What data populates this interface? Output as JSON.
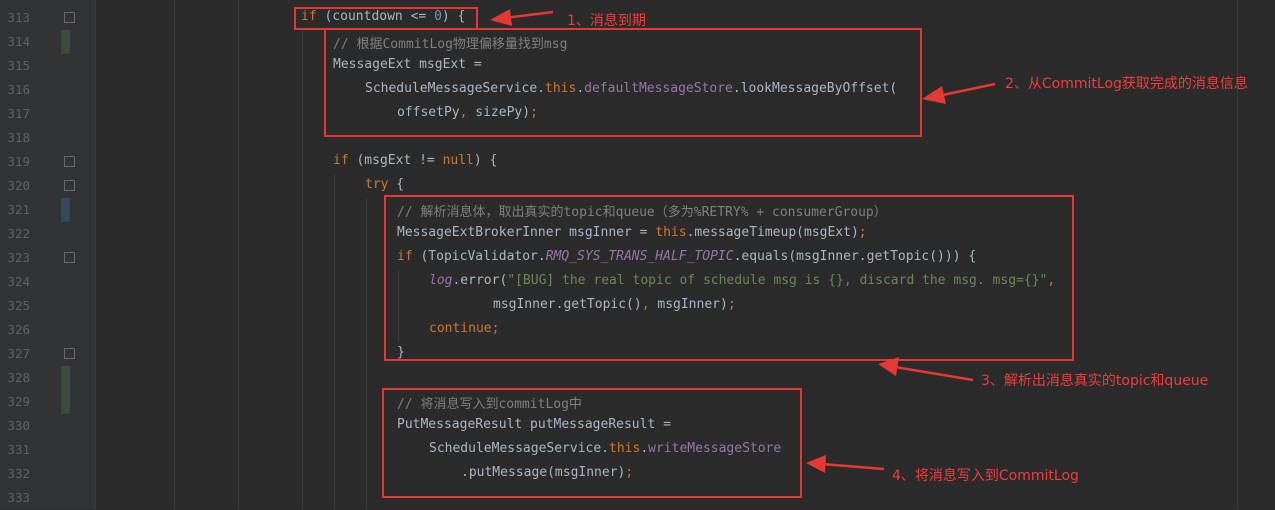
{
  "editor": {
    "lines": [
      {
        "num": "313",
        "indent": 0,
        "parts": [
          [
            "kw",
            "if"
          ],
          [
            "t",
            " (countdown <= "
          ],
          [
            "num",
            "0"
          ],
          [
            "t",
            ") {"
          ]
        ]
      },
      {
        "num": "314",
        "indent": 1,
        "parts": [
          [
            "cmt",
            "// 根据CommitLog物理偏移量找到msg"
          ]
        ]
      },
      {
        "num": "315",
        "indent": 1,
        "parts": [
          [
            "t",
            "MessageExt msgExt ="
          ]
        ]
      },
      {
        "num": "316",
        "indent": 2,
        "parts": [
          [
            "t",
            "ScheduleMessageService."
          ],
          [
            "kw",
            "this"
          ],
          [
            "t",
            "."
          ],
          [
            "fld",
            "defaultMessageStore"
          ],
          [
            "t",
            ".lookMessageByOffset("
          ]
        ]
      },
      {
        "num": "317",
        "indent": 3,
        "parts": [
          [
            "t",
            "offsetPy"
          ],
          [
            "kw",
            ","
          ],
          [
            "t",
            " sizePy)"
          ],
          [
            "kw",
            ";"
          ]
        ]
      },
      {
        "num": "318",
        "indent": 0,
        "parts": []
      },
      {
        "num": "319",
        "indent": 1,
        "parts": [
          [
            "kw",
            "if"
          ],
          [
            "t",
            " (msgExt != "
          ],
          [
            "kw",
            "null"
          ],
          [
            "t",
            ") {"
          ]
        ]
      },
      {
        "num": "320",
        "indent": 2,
        "parts": [
          [
            "kw",
            "try"
          ],
          [
            "t",
            " {"
          ]
        ]
      },
      {
        "num": "321",
        "indent": 3,
        "parts": [
          [
            "cmt",
            "// 解析消息体，取出真实的topic和queue（多为%RETRY% + consumerGroup）"
          ]
        ]
      },
      {
        "num": "322",
        "indent": 3,
        "parts": [
          [
            "t",
            "MessageExtBrokerInner msgInner = "
          ],
          [
            "kw",
            "this"
          ],
          [
            "t",
            ".messageTimeup(msgExt)"
          ],
          [
            "kw",
            ";"
          ]
        ]
      },
      {
        "num": "323",
        "indent": 3,
        "parts": [
          [
            "kw",
            "if"
          ],
          [
            "t",
            " (TopicValidator."
          ],
          [
            "ital",
            "RMQ_SYS_TRANS_HALF_TOPIC"
          ],
          [
            "t",
            ".equals(msgInner.getTopic())) {"
          ]
        ]
      },
      {
        "num": "324",
        "indent": 4,
        "parts": [
          [
            "ital",
            "log"
          ],
          [
            "t",
            ".error("
          ],
          [
            "str",
            "\"[BUG] the real topic of schedule msg is {}, discard the msg. msg={}\""
          ],
          [
            "kw",
            ","
          ]
        ]
      },
      {
        "num": "325",
        "indent": 6,
        "parts": [
          [
            "t",
            "msgInner.getTopic()"
          ],
          [
            "kw",
            ","
          ],
          [
            "t",
            " msgInner)"
          ],
          [
            "kw",
            ";"
          ]
        ]
      },
      {
        "num": "326",
        "indent": 4,
        "parts": [
          [
            "kw",
            "continue;"
          ]
        ]
      },
      {
        "num": "327",
        "indent": 3,
        "parts": [
          [
            "t",
            "}"
          ]
        ]
      },
      {
        "num": "328",
        "indent": 0,
        "parts": []
      },
      {
        "num": "329",
        "indent": 3,
        "parts": [
          [
            "cmt",
            "// 将消息写入到commitLog中"
          ]
        ]
      },
      {
        "num": "330",
        "indent": 3,
        "parts": [
          [
            "t",
            "PutMessageResult putMessageResult ="
          ]
        ]
      },
      {
        "num": "331",
        "indent": 4,
        "parts": [
          [
            "t",
            "ScheduleMessageService."
          ],
          [
            "kw",
            "this"
          ],
          [
            "t",
            "."
          ],
          [
            "fld",
            "writeMessageStore"
          ]
        ]
      },
      {
        "num": "332",
        "indent": 5,
        "parts": [
          [
            "t",
            ".putMessage(msgInner)"
          ],
          [
            "kw",
            ";"
          ]
        ]
      },
      {
        "num": "333",
        "indent": 0,
        "parts": []
      }
    ]
  },
  "annotations": {
    "note1": "1、消息到期",
    "note2": "2、从CommitLog获取完成的消息信息",
    "note3": "3、解析出消息真实的topic和queue",
    "note4": "4、将消息写入到CommitLog"
  },
  "colors": {
    "background": "#2b2b2b",
    "gutter": "#313335",
    "keyword": "#cc7832",
    "comment": "#808080",
    "string": "#6a8759",
    "field": "#9876aa",
    "number": "#6897bb",
    "annotation_red": "#e53935"
  }
}
